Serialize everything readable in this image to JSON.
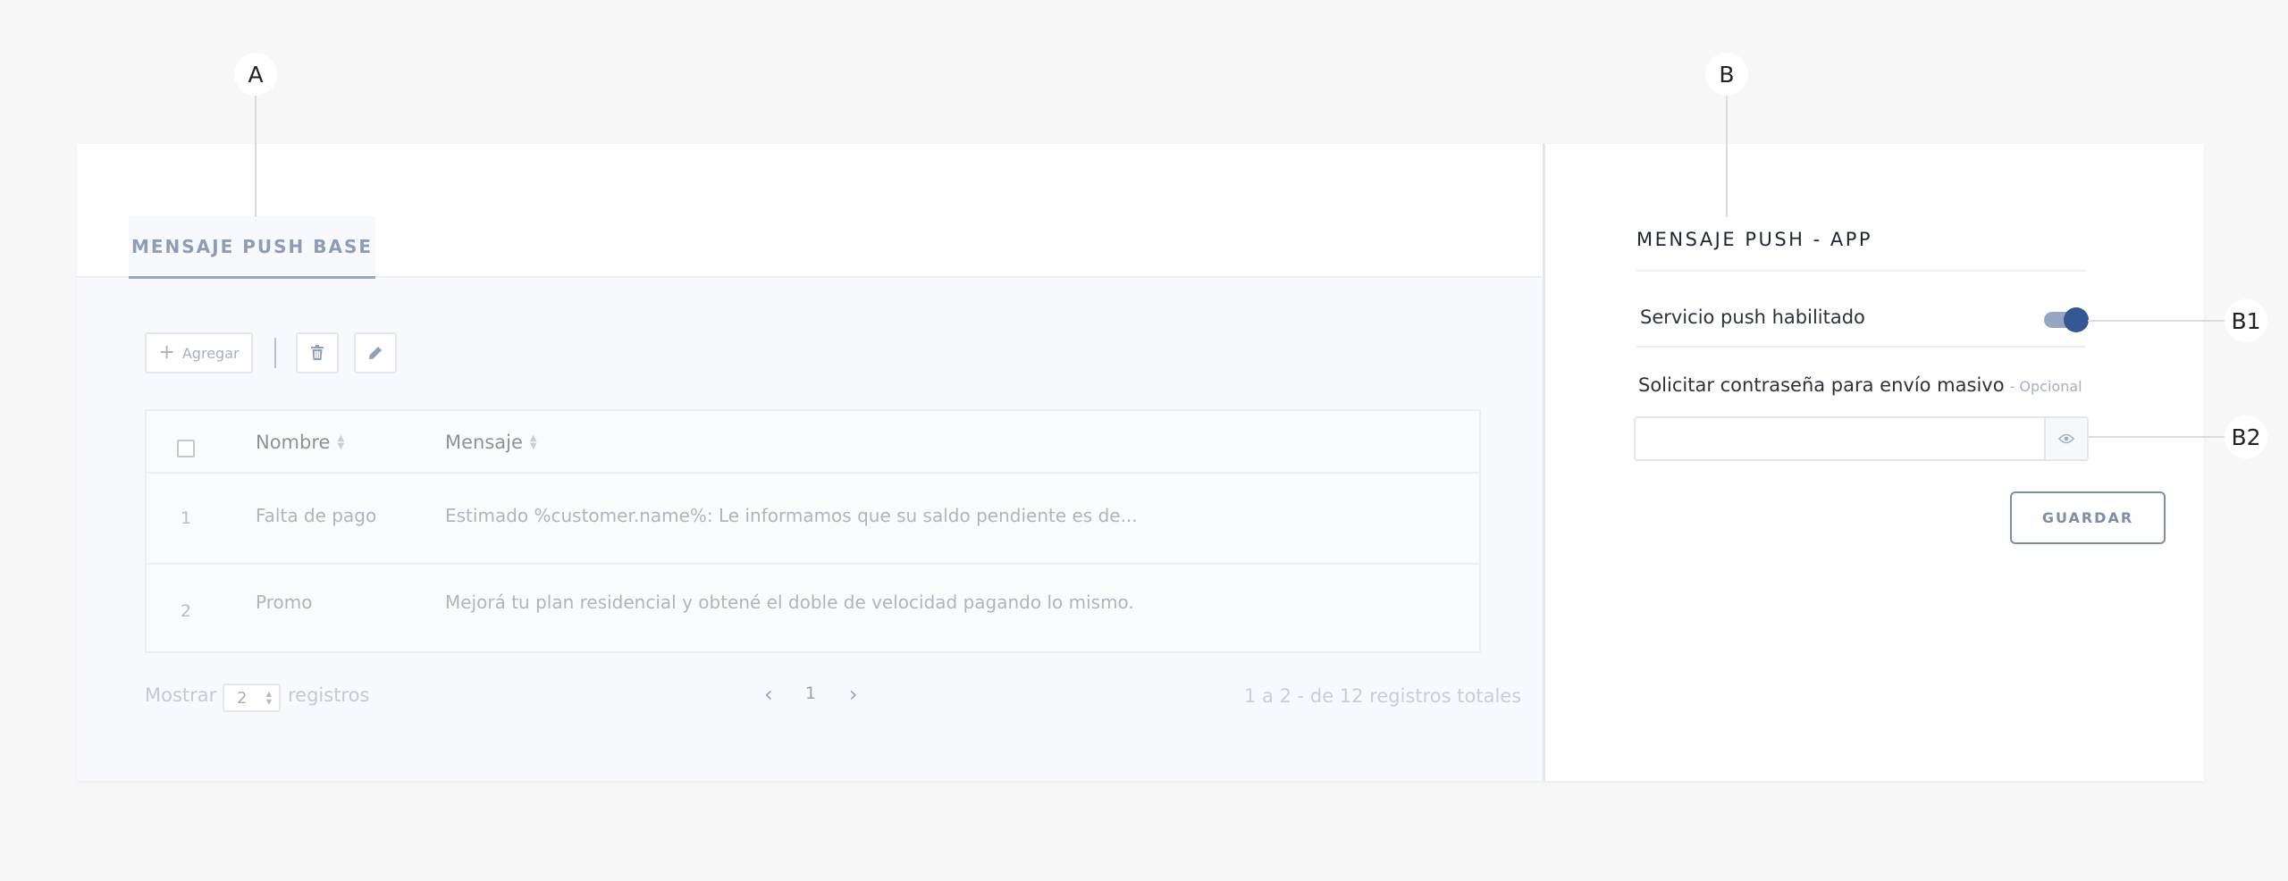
{
  "callouts": {
    "a": "A",
    "b": "B",
    "b1": "B1",
    "b2": "B2"
  },
  "tabs": {
    "active_label": "MENSAJE PUSH BASE"
  },
  "toolbar": {
    "add_label": "Agregar",
    "add_icon": "plus-icon",
    "delete_icon": "trash-icon",
    "edit_icon": "pencil-icon"
  },
  "table": {
    "columns": {
      "name": "Nombre",
      "message": "Mensaje"
    },
    "rows": [
      {
        "index": "1",
        "name": "Falta de pago",
        "message": "Estimado %customer.name%: Le informamos que su saldo pendiente es de..."
      },
      {
        "index": "2",
        "name": "Promo",
        "message": "Mejorá tu plan residencial y obtené el doble de velocidad pagando lo mismo."
      }
    ]
  },
  "footer": {
    "show_label": "Mostrar",
    "page_size": "2",
    "records_label": "registros",
    "current_page": "1",
    "summary": "1 a 2 - de 12 registros totales"
  },
  "settings": {
    "title": "MENSAJE PUSH - APP",
    "push_enabled_label": "Servicio push habilitado",
    "push_enabled": true,
    "password_label": "Solicitar contraseña para envío masivo",
    "password_optional": "- Opcional",
    "password_value": "",
    "save_label": "GUARDAR"
  },
  "colors": {
    "accent": "#345796",
    "accent_light": "#96a6c2",
    "tab_text": "#8e9db3"
  }
}
